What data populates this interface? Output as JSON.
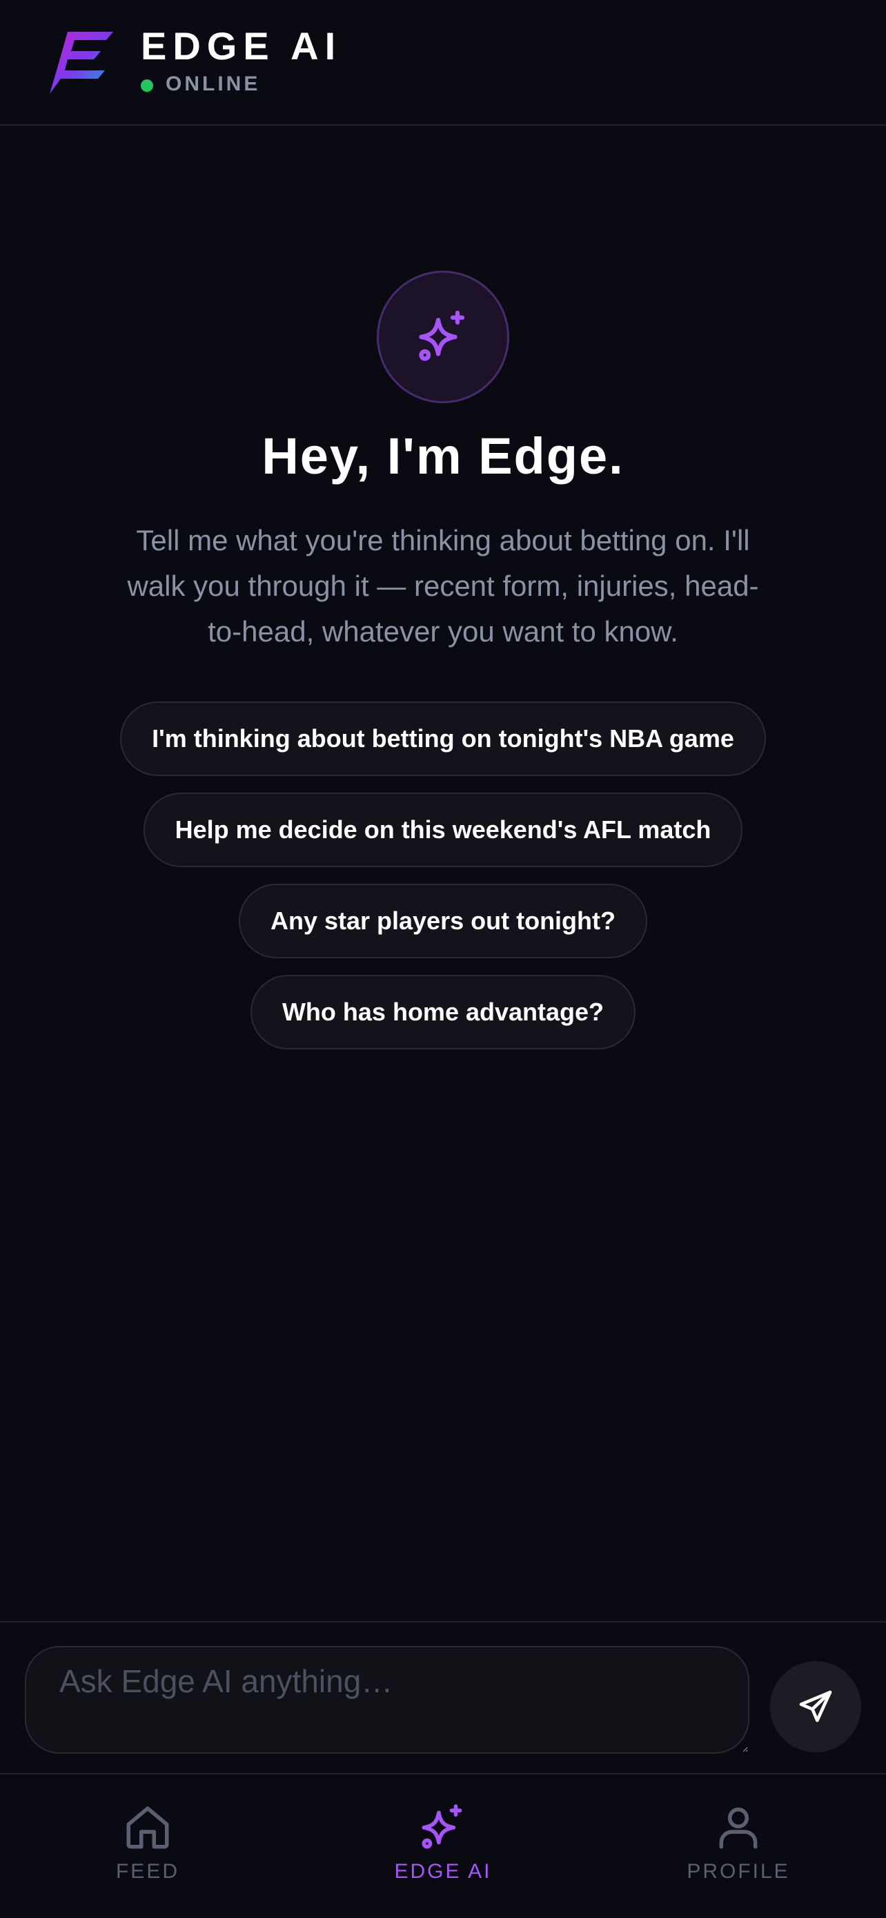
{
  "header": {
    "title": "EDGE AI",
    "status": "ONLINE",
    "status_color": "#22c55e"
  },
  "hero": {
    "icon": "sparkles-icon",
    "title": "Hey, I'm Edge.",
    "subtitle": "Tell me what you're thinking about betting on. I'll walk you through it — recent form, injuries, head-to-head, whatever you want to know."
  },
  "suggestions": [
    "I'm thinking about betting on tonight's NBA game",
    "Help me decide on this weekend's AFL match",
    "Any star players out tonight?",
    "Who has home advantage?"
  ],
  "composer": {
    "placeholder": "Ask Edge AI anything…",
    "send_icon": "send-icon"
  },
  "nav": {
    "items": [
      {
        "label": "FEED",
        "icon": "home-icon",
        "active": false
      },
      {
        "label": "EDGE AI",
        "icon": "sparkles-icon",
        "active": true
      },
      {
        "label": "PROFILE",
        "icon": "user-icon",
        "active": false
      }
    ]
  },
  "colors": {
    "background": "#0a0a12",
    "accent": "#a855f7",
    "muted_text": "#8a93a6"
  }
}
